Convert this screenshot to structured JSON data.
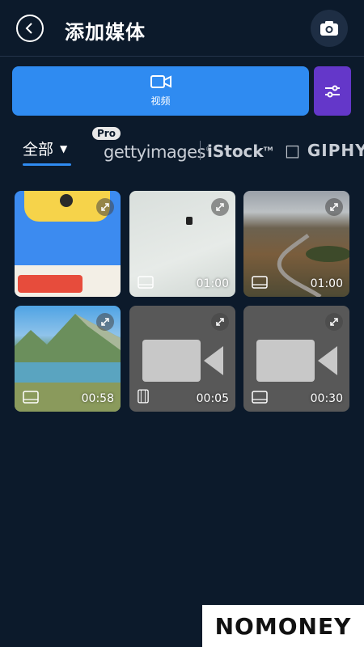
{
  "header": {
    "title": "添加媒体"
  },
  "toolbar": {
    "video_label": "视频"
  },
  "tabs": {
    "all_label": "全部",
    "pro_badge": "Pro",
    "getty": "gettyimages",
    "istock": "iStock",
    "giphy": "GIPHY"
  },
  "media": [
    {
      "kind": "image",
      "duration": ""
    },
    {
      "kind": "image",
      "duration": "01:00"
    },
    {
      "kind": "image",
      "duration": "01:00"
    },
    {
      "kind": "image",
      "duration": "00:58"
    },
    {
      "kind": "video",
      "duration": "00:05"
    },
    {
      "kind": "video",
      "duration": "00:30"
    }
  ],
  "watermark": {
    "text": "NOMONEY"
  },
  "colors": {
    "background": "#0c1a2b",
    "accent_blue": "#2f8bf1",
    "accent_purple": "#6437c9"
  }
}
